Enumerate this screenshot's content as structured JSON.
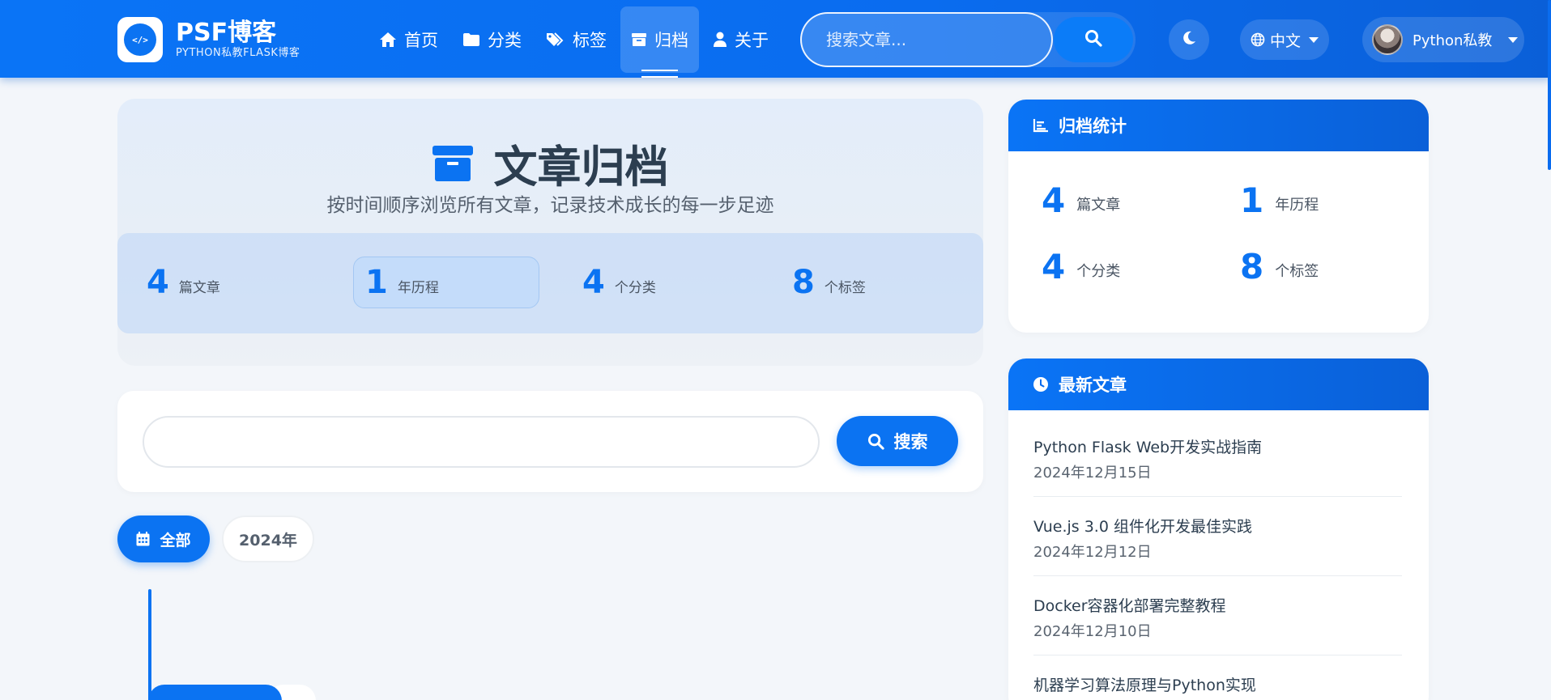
{
  "brand": {
    "title": "PSF博客",
    "subtitle": "PYTHON私教FLASK博客",
    "logo_glyph": "</>"
  },
  "nav": [
    {
      "label": "首页",
      "icon": "home-icon"
    },
    {
      "label": "分类",
      "icon": "folder-icon"
    },
    {
      "label": "标签",
      "icon": "tags-icon"
    },
    {
      "label": "归档",
      "icon": "archive-icon",
      "active": true
    },
    {
      "label": "关于",
      "icon": "user-icon"
    }
  ],
  "search": {
    "placeholder": "搜索文章..."
  },
  "language": {
    "label": "中文"
  },
  "user": {
    "name": "Python私教"
  },
  "hero": {
    "title": "文章归档",
    "subtitle": "按时间顺序浏览所有文章，记录技术成长的每一步足迹",
    "stats": [
      {
        "num": "4",
        "label": "篇文章"
      },
      {
        "num": "1",
        "label": "年历程",
        "active": true
      },
      {
        "num": "4",
        "label": "个分类"
      },
      {
        "num": "8",
        "label": "个标签"
      }
    ]
  },
  "archive_search": {
    "value": "",
    "button_label": "搜索"
  },
  "filters": {
    "all_label": "全部",
    "year_label": "2024年"
  },
  "sidebar": {
    "stats_title": "归档统计",
    "stats": [
      {
        "num": "4",
        "label": "篇文章"
      },
      {
        "num": "1",
        "label": "年历程"
      },
      {
        "num": "4",
        "label": "个分类"
      },
      {
        "num": "8",
        "label": "个标签"
      }
    ],
    "recent_title": "最新文章",
    "recent": [
      {
        "title": "Python Flask Web开发实战指南",
        "date": "2024年12月15日"
      },
      {
        "title": "Vue.js 3.0 组件化开发最佳实践",
        "date": "2024年12月12日"
      },
      {
        "title": "Docker容器化部署完整教程",
        "date": "2024年12月10日"
      },
      {
        "title": "机器学习算法原理与Python实现",
        "date": ""
      }
    ]
  },
  "colors": {
    "primary": "#0b73f2",
    "navbar": "#0a6cef",
    "text": "#2c3e50",
    "background": "#f3f6fa"
  }
}
